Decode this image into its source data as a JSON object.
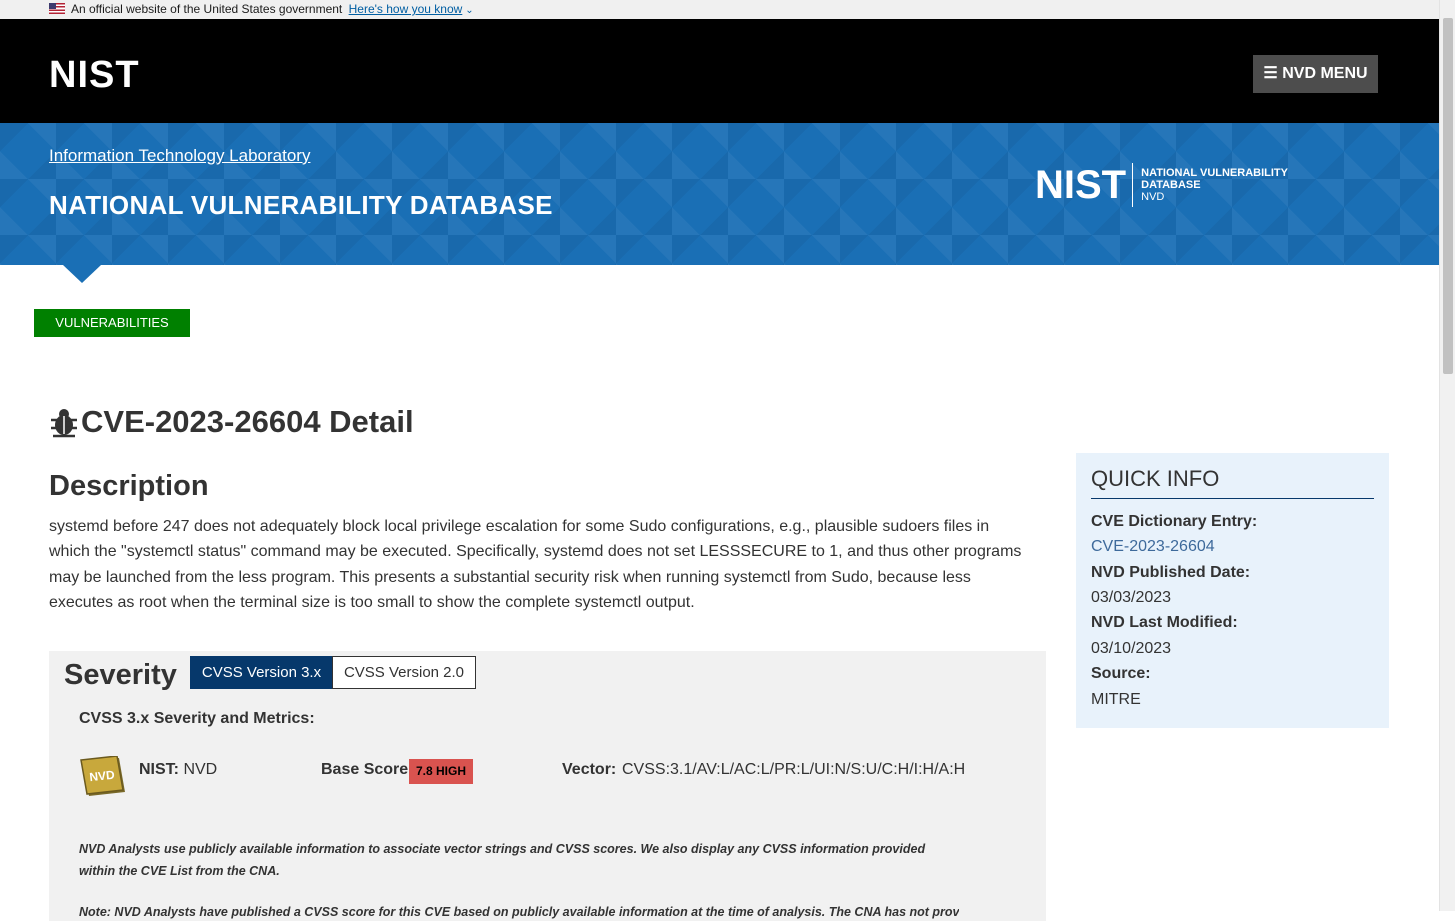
{
  "gov_banner": {
    "text": "An official website of the United States government",
    "link": "Here's how you know"
  },
  "header": {
    "logo": "NIST",
    "menu_label": "NVD MENU"
  },
  "hero": {
    "itl_link": "Information Technology Laboratory",
    "title": "NATIONAL VULNERABILITY DATABASE",
    "logo_big": "NIST",
    "logo_line1": "NATIONAL VULNERABILITY",
    "logo_line2": "DATABASE",
    "logo_line3": "NVD"
  },
  "nav": {
    "vulnerabilities_label": "VULNERABILITIES"
  },
  "cve": {
    "title": "CVE-2023-26604 Detail",
    "description_heading": "Description",
    "description": "systemd before 247 does not adequately block local privilege escalation for some Sudo configurations, e.g., plausible sudoers files in which the \"systemctl status\" command may be executed. Specifically, systemd does not set LESSSECURE to 1, and thus other programs may be launched from the less program. This presents a substantial security risk when running systemctl from Sudo, because less executes as root when the terminal size is too small to show the complete systemctl output."
  },
  "severity": {
    "heading": "Severity",
    "tab_v3": "CVSS Version 3.x",
    "tab_v2": "CVSS Version 2.0",
    "metrics_heading": "CVSS 3.x Severity and Metrics:",
    "badge_text": "NVD",
    "nist_label": "NIST:",
    "nist_value": "NVD",
    "base_score_label": "Base Score:",
    "base_score": "7.8 HIGH",
    "vector_label": "Vector:",
    "vector_value": "CVSS:3.1/AV:L/AC:L/PR:L/UI:N/S:U/C:H/I:H/A:H",
    "note1": "NVD Analysts use publicly available information to associate vector strings and CVSS scores. We also display any CVSS information provided within the CVE List from the CNA.",
    "note2": "Note: NVD Analysts have published a CVSS score for this CVE based on publicly available information at the time of analysis. The CNA has not provided"
  },
  "quick_info": {
    "heading": "QUICK INFO",
    "dict_label": "CVE Dictionary Entry:",
    "dict_value": "CVE-2023-26604",
    "published_label": "NVD Published Date:",
    "published_value": "03/03/2023",
    "modified_label": "NVD Last Modified:",
    "modified_value": "03/10/2023",
    "source_label": "Source:",
    "source_value": "MITRE"
  },
  "colors": {
    "hero_blue": "#1a6fb5",
    "nav_green": "#008000",
    "tab_active": "#06386b",
    "high_severity": "#d9534f"
  }
}
